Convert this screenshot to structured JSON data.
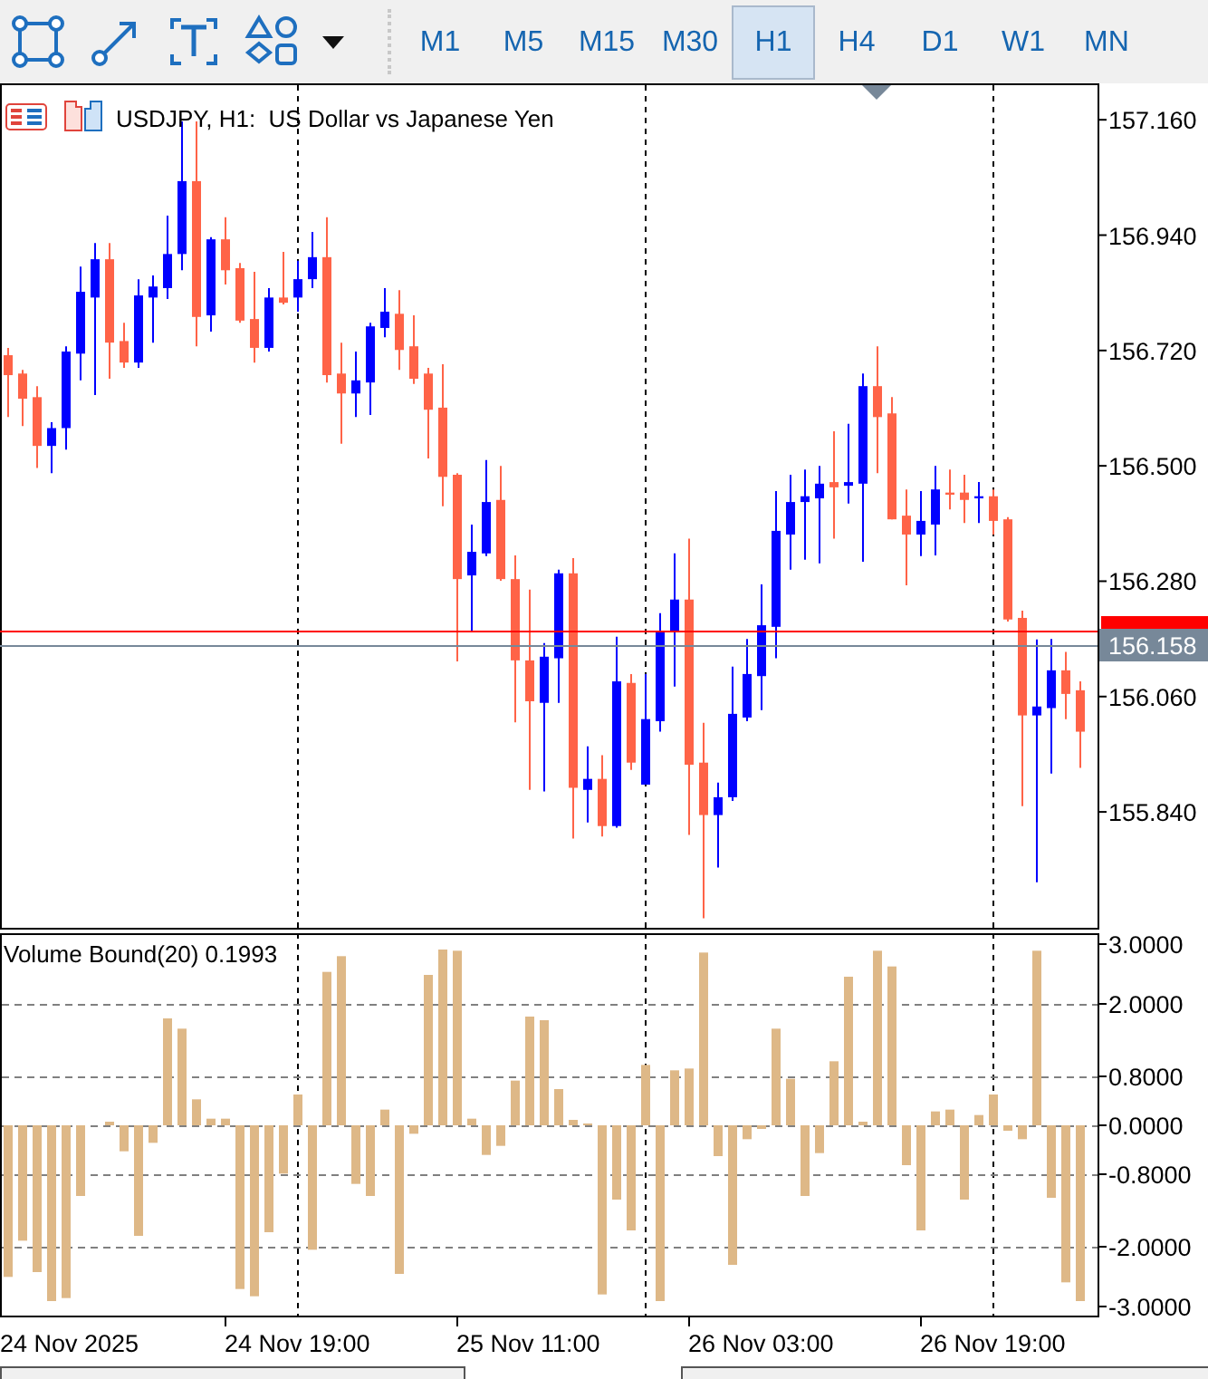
{
  "timeframes": [
    {
      "label": "M1",
      "selected": false
    },
    {
      "label": "M5",
      "selected": false
    },
    {
      "label": "M15",
      "selected": false
    },
    {
      "label": "M30",
      "selected": false
    },
    {
      "label": "H1",
      "selected": true
    },
    {
      "label": "H4",
      "selected": false
    },
    {
      "label": "D1",
      "selected": false
    },
    {
      "label": "W1",
      "selected": false
    },
    {
      "label": "MN",
      "selected": false
    }
  ],
  "chart": {
    "title": "USDJPY, H1:  US Dollar vs Japanese Yen",
    "last_label": "156.158",
    "chart_data": {
      "type": "candlestick",
      "categories": [
        null,
        null,
        null,
        null,
        null,
        null,
        null,
        null,
        null,
        null,
        null,
        null,
        null,
        null,
        null,
        null,
        null,
        null,
        null,
        null,
        null,
        null,
        null,
        null,
        null,
        null,
        null,
        null,
        null,
        null,
        null,
        null,
        null,
        null,
        null,
        null,
        null,
        null,
        null,
        null,
        null,
        null,
        null,
        null,
        null,
        null,
        null,
        null,
        null,
        null,
        null,
        null,
        null,
        null,
        null,
        null,
        null,
        null,
        null,
        null,
        null,
        null,
        null,
        null,
        null,
        null,
        null,
        null,
        null,
        null,
        null,
        null,
        null,
        null,
        null
      ],
      "ylim": [
        155.619,
        157.226
      ],
      "yticks": [
        {
          "value": 157.16,
          "label": "157.160"
        },
        {
          "value": 156.94,
          "label": "156.940"
        },
        {
          "value": 156.72,
          "label": "156.720"
        },
        {
          "value": 156.5,
          "label": "156.500"
        },
        {
          "value": 156.28,
          "label": "156.280"
        },
        {
          "value": 156.06,
          "label": "156.060"
        },
        {
          "value": 155.84,
          "label": "155.840"
        }
      ],
      "ohlc": [
        [
          156.711,
          156.725,
          156.593,
          156.673
        ],
        [
          156.676,
          156.683,
          156.576,
          156.628
        ],
        [
          156.631,
          156.652,
          156.496,
          156.538
        ],
        [
          156.538,
          156.583,
          156.486,
          156.572
        ],
        [
          156.572,
          156.728,
          156.531,
          156.718
        ],
        [
          156.714,
          156.88,
          156.663,
          156.832
        ],
        [
          156.821,
          156.925,
          156.635,
          156.894
        ],
        [
          156.894,
          156.925,
          156.666,
          156.735
        ],
        [
          156.738,
          156.773,
          156.687,
          156.697
        ],
        [
          156.697,
          156.856,
          156.687,
          156.825
        ],
        [
          156.821,
          156.863,
          156.735,
          156.842
        ],
        [
          156.839,
          156.977,
          156.818,
          156.904
        ],
        [
          156.904,
          157.157,
          156.873,
          157.043
        ],
        [
          157.043,
          157.157,
          156.728,
          156.784
        ],
        [
          156.787,
          156.936,
          156.756,
          156.932
        ],
        [
          156.932,
          156.974,
          156.846,
          156.873
        ],
        [
          156.877,
          156.887,
          156.773,
          156.777
        ],
        [
          156.78,
          156.87,
          156.697,
          156.725
        ],
        [
          156.725,
          156.839,
          156.718,
          156.821
        ],
        [
          156.821,
          156.908,
          156.808,
          156.811
        ],
        [
          156.821,
          156.891,
          156.794,
          156.856
        ],
        [
          156.856,
          156.946,
          156.839,
          156.898
        ],
        [
          156.898,
          156.974,
          156.659,
          156.673
        ],
        [
          156.676,
          156.735,
          156.542,
          156.638
        ],
        [
          156.638,
          156.718,
          156.593,
          156.663
        ],
        [
          156.659,
          156.773,
          156.597,
          156.766
        ],
        [
          156.763,
          156.839,
          156.745,
          156.794
        ],
        [
          156.79,
          156.835,
          156.683,
          156.721
        ],
        [
          156.728,
          156.787,
          156.656,
          156.666
        ],
        [
          156.676,
          156.687,
          156.514,
          156.607
        ],
        [
          156.611,
          156.694,
          156.423,
          156.479
        ],
        [
          156.483,
          156.486,
          156.127,
          156.284
        ],
        [
          156.291,
          156.388,
          156.184,
          156.336
        ],
        [
          156.333,
          156.511,
          156.328,
          156.431
        ],
        [
          156.435,
          156.5,
          156.281,
          156.284
        ],
        [
          156.284,
          156.329,
          156.011,
          156.129
        ],
        [
          156.129,
          156.264,
          155.882,
          156.051
        ],
        [
          156.048,
          156.162,
          155.879,
          156.136
        ],
        [
          156.133,
          156.302,
          156.048,
          156.295
        ],
        [
          156.295,
          156.324,
          155.789,
          155.886
        ],
        [
          155.882,
          155.965,
          155.82,
          155.903
        ],
        [
          155.903,
          155.948,
          155.793,
          155.813
        ],
        [
          155.813,
          156.174,
          155.81,
          156.089
        ],
        [
          156.086,
          156.103,
          155.92,
          155.934
        ],
        [
          155.892,
          156.103,
          155.892,
          156.017
        ],
        [
          156.013,
          156.219,
          155.993,
          156.184
        ],
        [
          156.184,
          156.333,
          156.079,
          156.245
        ],
        [
          156.245,
          156.361,
          155.796,
          155.93
        ],
        [
          155.934,
          156.01,
          155.637,
          155.834
        ],
        [
          155.834,
          155.896,
          155.734,
          155.868
        ],
        [
          155.868,
          156.117,
          155.861,
          156.027
        ],
        [
          156.02,
          156.17,
          156.013,
          156.103
        ],
        [
          156.099,
          156.274,
          156.034,
          156.196
        ],
        [
          156.193,
          156.452,
          156.133,
          156.376
        ],
        [
          156.369,
          156.483,
          156.302,
          156.431
        ],
        [
          156.431,
          156.493,
          156.321,
          156.442
        ],
        [
          156.438,
          156.5,
          156.314,
          156.466
        ],
        [
          156.469,
          156.566,
          156.361,
          156.459
        ],
        [
          156.462,
          156.58,
          156.428,
          156.469
        ],
        [
          156.466,
          156.676,
          156.317,
          156.652
        ],
        [
          156.652,
          156.728,
          156.486,
          156.593
        ],
        [
          156.6,
          156.631,
          156.398,
          156.398
        ],
        [
          156.405,
          156.455,
          156.272,
          156.369
        ],
        [
          156.369,
          156.452,
          156.328,
          156.395
        ],
        [
          156.388,
          156.5,
          156.329,
          156.455
        ],
        [
          156.449,
          156.493,
          156.417,
          156.445
        ],
        [
          156.449,
          156.483,
          156.391,
          156.435
        ],
        [
          156.438,
          156.469,
          156.391,
          156.442
        ],
        [
          156.442,
          156.455,
          156.369,
          156.395
        ],
        [
          156.398,
          156.402,
          156.203,
          156.207
        ],
        [
          156.21,
          156.224,
          155.851,
          156.024
        ],
        [
          156.024,
          156.169,
          155.706,
          156.041
        ],
        [
          156.038,
          156.17,
          155.913,
          156.11
        ],
        [
          156.11,
          156.145,
          156.017,
          156.065
        ],
        [
          156.072,
          156.089,
          155.924,
          155.993
        ]
      ]
    }
  },
  "time_labels": [
    "24 Nov 2025",
    "24 Nov 19:00",
    "25 Nov 11:00",
    "26 Nov 03:00",
    "26 Nov 19:00"
  ],
  "indicator": {
    "title": "Volume Bound(20) 0.1993",
    "chart_data": {
      "type": "bar",
      "yticks": [
        {
          "value": 3,
          "label": "3.0000"
        },
        {
          "value": 2,
          "label": "2.0000"
        },
        {
          "value": 0.8,
          "label": "0.8000"
        },
        {
          "value": 0,
          "label": "0.0000"
        },
        {
          "value": -0.8,
          "label": "-0.8000"
        },
        {
          "value": -2,
          "label": "-2.0000"
        },
        {
          "value": -3,
          "label": "-3.0000"
        }
      ],
      "ylim": [
        -3.15,
        3.15
      ],
      "categories": [
        null,
        null,
        null,
        null,
        null,
        null,
        null,
        null,
        null,
        null,
        null,
        null,
        null,
        null,
        null,
        null,
        null,
        null,
        null,
        null,
        null,
        null,
        null,
        null,
        null,
        null,
        null,
        null,
        null,
        null,
        null,
        null,
        null,
        null,
        null,
        null,
        null,
        null,
        null,
        null,
        null,
        null,
        null,
        null,
        null,
        null,
        null,
        null,
        null,
        null,
        null,
        null,
        null,
        null,
        null,
        null,
        null,
        null,
        null,
        null,
        null,
        null,
        null,
        null,
        null,
        null,
        null,
        null,
        null,
        null,
        null,
        null,
        null,
        null,
        null
      ],
      "series": [
        {
          "color": "#deb887",
          "values": [
            -2.51,
            -1.91,
            -2.43,
            -2.91,
            -2.86,
            -1.17,
            0,
            0.06,
            -0.43,
            -1.83,
            -0.29,
            1.77,
            1.6,
            0.43,
            0.11,
            0.11,
            -2.71,
            -2.83,
            -1.77,
            -0.8,
            0.51,
            -2.06,
            2.54,
            2.8,
            -0.97,
            -1.17,
            0.26,
            -2.46,
            -0.14,
            2.49,
            2.91,
            2.89,
            0.11,
            -0.49,
            -0.34,
            0.74,
            1.8,
            1.74,
            0.6,
            0.09,
            0.03,
            -2.8,
            -1.23,
            -1.74,
            1.0,
            -2.91,
            0.91,
            0.94,
            2.86,
            -0.51,
            -2.31,
            -0.23,
            -0.06,
            1.6,
            0.77,
            -1.17,
            -0.46,
            1.06,
            2.46,
            0.06,
            2.89,
            2.63,
            -0.66,
            -1.74,
            0.23,
            0.26,
            -1.23,
            0.17,
            0.51,
            -0.09,
            -0.23,
            2.89,
            -1.2,
            -2.6,
            -2.91
          ]
        }
      ]
    }
  }
}
